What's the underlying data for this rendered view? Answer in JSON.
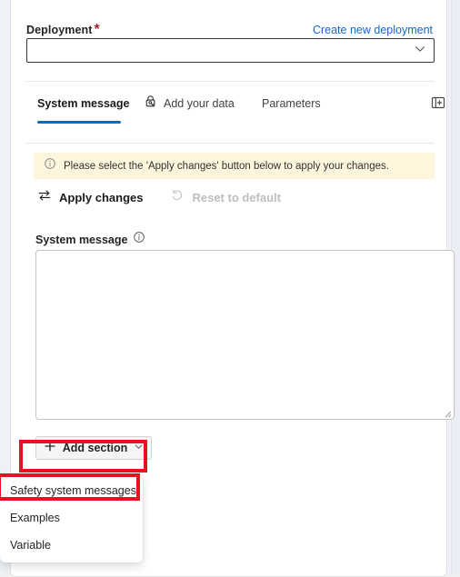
{
  "deployment": {
    "label": "Deployment",
    "required_marker": "*",
    "create_link": "Create new deployment",
    "selected_value": "",
    "placeholder": "",
    "chevron_icon": "chevron-down-icon"
  },
  "tabs": [
    {
      "id": "system",
      "label": "System message",
      "active": true,
      "icon": null
    },
    {
      "id": "data",
      "label": "Add your data",
      "active": false,
      "icon": "lock-key-icon"
    },
    {
      "id": "params",
      "label": "Parameters",
      "active": false,
      "icon": null
    }
  ],
  "panel_toggle": {
    "icon": "panel-expand-icon",
    "tooltip": ""
  },
  "banner": {
    "icon": "info-circle-icon",
    "text": "Please select the 'Apply changes' button below to apply your changes.",
    "background": "#FDF6DD"
  },
  "commands": [
    {
      "id": "apply",
      "label": "Apply changes",
      "icon": "swap-arrows-icon",
      "disabled": false
    },
    {
      "id": "reset",
      "label": "Reset to default",
      "icon": "undo-arrow-icon",
      "disabled": true
    }
  ],
  "system_message": {
    "label": "System message",
    "info_icon": "info-circle-icon",
    "value": "",
    "placeholder": "",
    "resize_handle": "resize-grip-icon"
  },
  "add_section": {
    "label": "Add section",
    "plus_icon": "plus-icon",
    "chevron_icon": "chevron-down-small-icon",
    "expanded": true
  },
  "add_section_menu": {
    "items": [
      {
        "id": "safety",
        "label": "Safety system messages",
        "highlighted": true
      },
      {
        "id": "examples",
        "label": "Examples",
        "highlighted": false
      },
      {
        "id": "variable",
        "label": "Variable",
        "highlighted": false
      }
    ]
  },
  "highlights": [
    {
      "id": "add-section-button",
      "color": "#E81123"
    },
    {
      "id": "safety-system-messages-item",
      "color": "#E81123"
    }
  ],
  "colors": {
    "accent": "#0F6CBD",
    "link": "#1567C4",
    "required": "#A4262C",
    "banner_bg": "#FDF6DD",
    "highlight": "#E81123",
    "text": "#242424",
    "disabled_text": "#BDBDBD"
  }
}
